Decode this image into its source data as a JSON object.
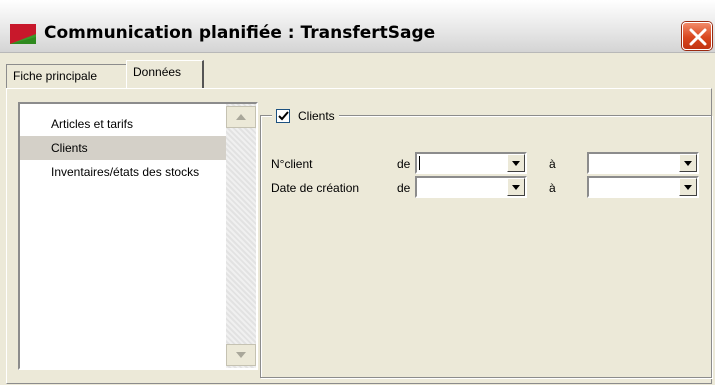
{
  "window": {
    "title": "Communication planifiée : TransfertSage",
    "icon": "app-flag-icon",
    "close_icon": "close-icon"
  },
  "tabs": [
    {
      "label": "Fiche principale",
      "active": false
    },
    {
      "label": "Données",
      "active": true
    }
  ],
  "data_list": {
    "items": [
      {
        "label": "Articles et tarifs",
        "selected": false
      },
      {
        "label": "Clients",
        "selected": true
      },
      {
        "label": "Inventaires/états des stocks",
        "selected": false
      }
    ]
  },
  "clients_group": {
    "checkbox_label": "Clients",
    "checked": true,
    "rows": [
      {
        "label": "N°client",
        "from_label": "de",
        "from_value": "",
        "to_label": "à",
        "to_value": ""
      },
      {
        "label": "Date de création",
        "from_label": "de",
        "from_value": "",
        "to_label": "à",
        "to_value": ""
      }
    ]
  },
  "colors": {
    "window_bg": "#ece9d8",
    "selection_bg": "#d4d0c8",
    "close_button": "#d9471f"
  }
}
